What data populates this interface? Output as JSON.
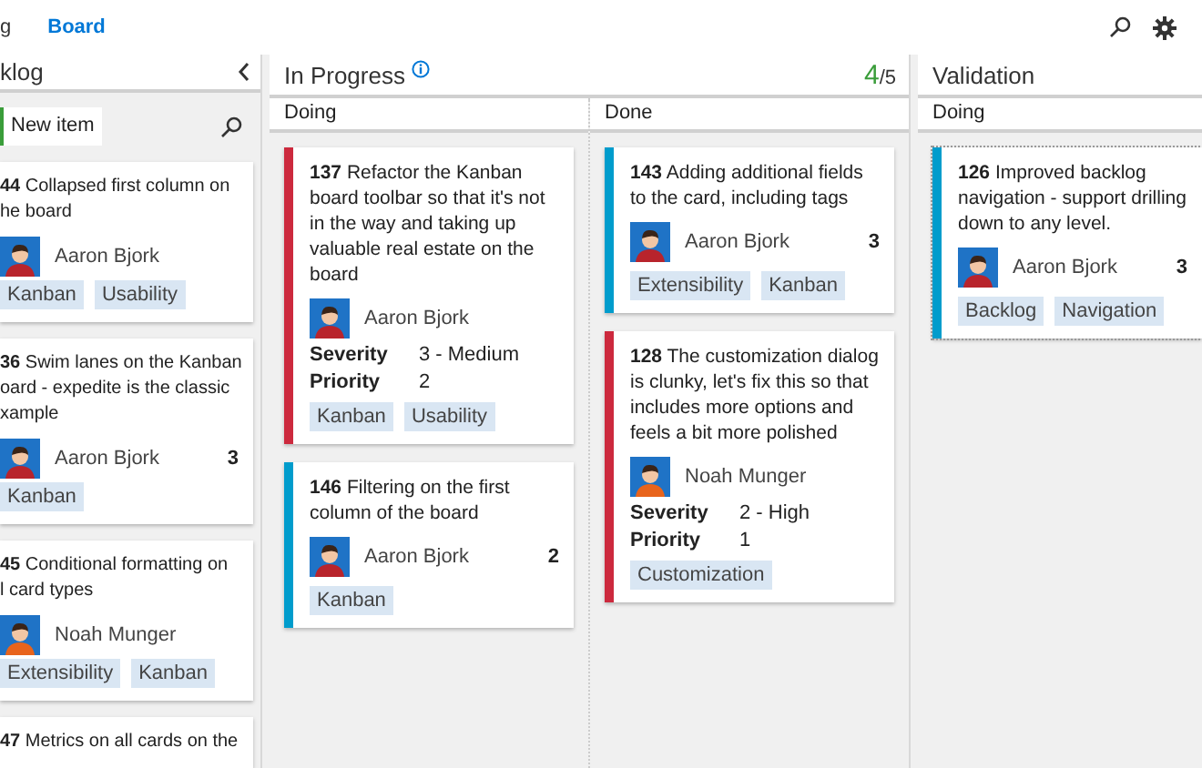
{
  "nav": {
    "tabs": [
      {
        "label": "g",
        "selected": false
      },
      {
        "label": "Board",
        "selected": true
      }
    ]
  },
  "backlog": {
    "title": "klog",
    "new_item": "New item",
    "cards": [
      {
        "id": "44",
        "lines": [
          "Collapsed first  column on",
          "he board"
        ],
        "assignee": {
          "name": "Aaron Bjork",
          "color": "#b8242c"
        },
        "tags": [
          "Kanban",
          "Usability"
        ]
      },
      {
        "id": "36",
        "lines": [
          "Swim lanes on the Kanban",
          "oard - expedite is the classic",
          "xample"
        ],
        "assignee": {
          "name": "Aaron Bjork",
          "color": "#b8242c"
        },
        "effort": "3",
        "tags": [
          "Kanban"
        ]
      },
      {
        "id": "45",
        "lines": [
          "Conditional formatting on",
          "l card types"
        ],
        "assignee": {
          "name": "Noah Munger",
          "color": "#e8641c"
        },
        "tags": [
          "Extensibility",
          "Kanban"
        ]
      },
      {
        "id": "47",
        "lines": [
          "Metrics on all cards on the"
        ]
      }
    ]
  },
  "columns": [
    {
      "title": "In Progress",
      "info": true,
      "wip": {
        "count": "4",
        "limit": "/5"
      },
      "lanes": [
        {
          "title": "Doing",
          "cards": [
            {
              "kind": "bug",
              "focused": false,
              "id": "137",
              "title": "Refactor the Kanban board toolbar so that it's not in the way and taking up valuable real estate on the board",
              "assignee": {
                "name": "Aaron Bjork",
                "color": "#b8242c"
              },
              "fields": [
                {
                  "label": "Severity",
                  "value": "3 - Medium"
                },
                {
                  "label": "Priority",
                  "value": "2"
                }
              ],
              "tags": [
                "Kanban",
                "Usability"
              ]
            },
            {
              "kind": "pbi",
              "focused": false,
              "id": "146",
              "title": "Filtering on the first column of the board",
              "assignee": {
                "name": "Aaron Bjork",
                "color": "#b8242c"
              },
              "effort": "2",
              "tags": [
                "Kanban"
              ]
            }
          ]
        },
        {
          "title": "Done",
          "cards": [
            {
              "kind": "pbi",
              "focused": false,
              "id": "143",
              "title": "Adding additional fields to the card, including tags",
              "assignee": {
                "name": "Aaron Bjork",
                "color": "#b8242c"
              },
              "effort": "3",
              "tags": [
                "Extensibility",
                "Kanban"
              ]
            },
            {
              "kind": "bug",
              "focused": false,
              "id": "128",
              "title": "The customization dialog is clunky, let's fix this so that includes more options and feels a bit more polished",
              "assignee": {
                "name": "Noah Munger",
                "color": "#e8641c"
              },
              "fields": [
                {
                  "label": "Severity",
                  "value": "2 - High"
                },
                {
                  "label": "Priority",
                  "value": "1"
                }
              ],
              "tags": [
                "Customization"
              ]
            }
          ]
        }
      ]
    },
    {
      "title": "Validation",
      "info": false,
      "lanes": [
        {
          "title": "Doing",
          "cards": [
            {
              "kind": "pbi",
              "focused": true,
              "id": "126",
              "title": "Improved backlog navigation - support drilling down to any level.",
              "assignee": {
                "name": "Aaron Bjork",
                "color": "#b8242c"
              },
              "effort": "3",
              "tags": [
                "Backlog",
                "Navigation"
              ]
            }
          ]
        }
      ]
    }
  ]
}
